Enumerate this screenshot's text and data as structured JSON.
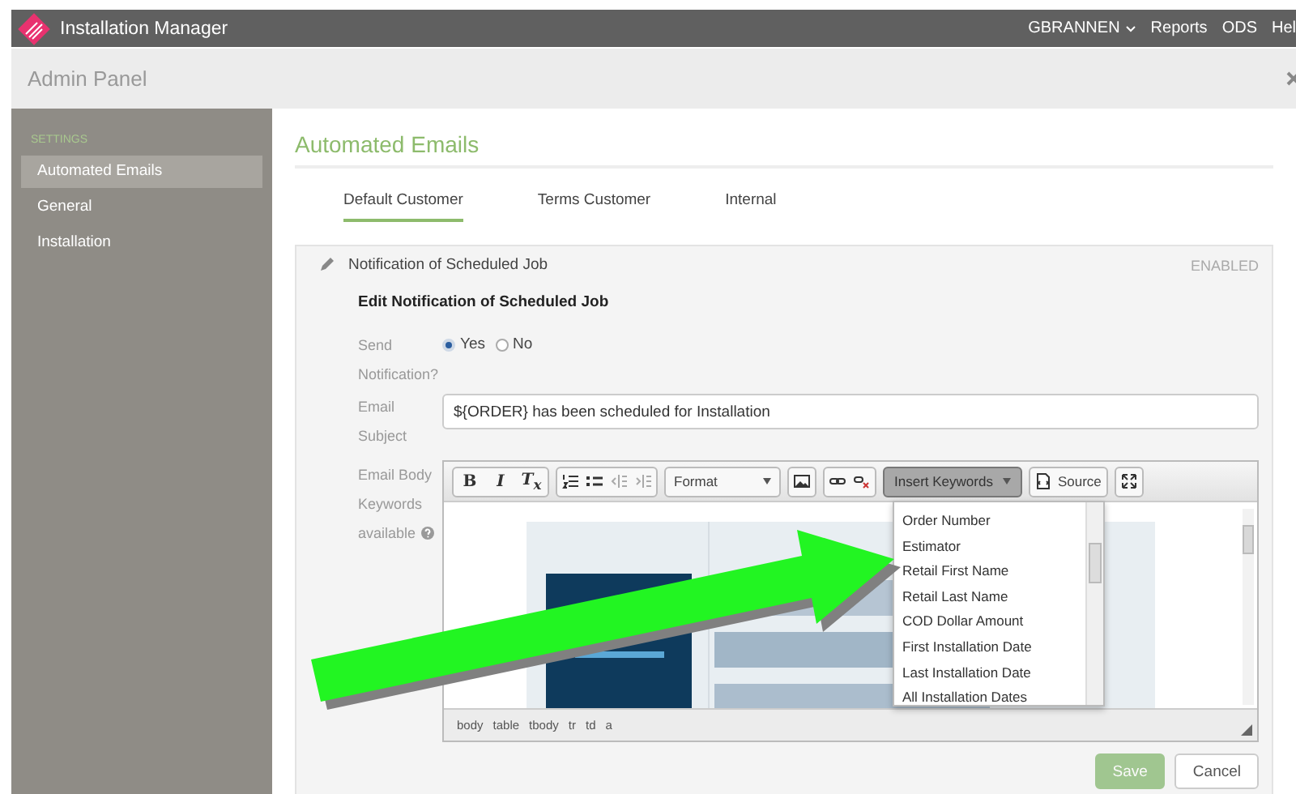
{
  "app": {
    "title": "Installation Manager",
    "user": "GBRANNEN",
    "nav": [
      "Reports",
      "ODS",
      "Hel"
    ]
  },
  "panel": {
    "title": "Admin Panel"
  },
  "sidebar": {
    "section": "SETTINGS",
    "items": [
      {
        "label": "Automated Emails",
        "selected": true
      },
      {
        "label": "General",
        "selected": false
      },
      {
        "label": "Installation",
        "selected": false
      }
    ]
  },
  "page": {
    "title": "Automated Emails",
    "tabs": [
      {
        "label": "Default Customer",
        "selected": true
      },
      {
        "label": "Terms Customer",
        "selected": false
      },
      {
        "label": "Internal",
        "selected": false
      }
    ]
  },
  "notification": {
    "title": "Notification of Scheduled Job",
    "status": "ENABLED",
    "form_title": "Edit Notification of Scheduled Job",
    "send": {
      "label": "Send Notification?",
      "options": [
        {
          "label": "Yes",
          "selected": true
        },
        {
          "label": "No",
          "selected": false
        }
      ]
    },
    "subject": {
      "label": "Email Subject",
      "value": "${ORDER} has been scheduled for Installation"
    },
    "body": {
      "label": "Email Body Keywords available",
      "toolbar": {
        "bold": "B",
        "italic": "I",
        "clear": "T$_{x}$",
        "format": "Format",
        "insert": "Insert Keywords",
        "source": "Source"
      },
      "path": [
        "body",
        "table",
        "tbody",
        "tr",
        "td",
        "a"
      ]
    },
    "keywords_menu": {
      "items": [
        "Order Number",
        "Estimator",
        "Retail First Name",
        "Retail Last Name",
        "COD Dollar Amount",
        "First Installation Date",
        "Last Installation Date",
        "All Installation Dates"
      ]
    }
  },
  "buttons": [
    {
      "label": "Save",
      "kind": "primary",
      "disabled": true
    },
    {
      "label": "Cancel",
      "kind": "secondary",
      "disabled": false
    }
  ]
}
